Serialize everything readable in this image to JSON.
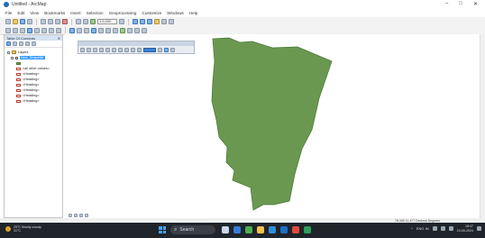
{
  "window": {
    "title": "Untitled - ArcMap",
    "controls": [
      "–",
      "□",
      "✕"
    ]
  },
  "menu": [
    "File",
    "Edit",
    "View",
    "Bookmarks",
    "Insert",
    "Selection",
    "Geoprocessing",
    "Customize",
    "Windows",
    "Help"
  ],
  "toolbar": {
    "scale": "1:6,000"
  },
  "toc": {
    "title": "Table Of Contents",
    "root": "Layers",
    "layer": "New_Shapefile",
    "classes": [
      "<all other values>",
      "<Heading>",
      "<Heading>",
      "<Heading>",
      "<Heading>",
      "<Heading>",
      "<Heading>"
    ]
  },
  "map": {
    "polygon_color": "#6a9850",
    "polygon_stroke": "#4e7a36"
  },
  "status": {
    "coordinates": "78.305  11.477 Decimal Degrees"
  },
  "taskbar": {
    "weather_temp": "29°C Mostly cloudy",
    "weather_sub": "31°C",
    "search_placeholder": "Search",
    "tray_lang": "ENG IN",
    "time": "18:47",
    "date": "19-05-2024"
  },
  "colors": {
    "taskbar_bg": "#20242b",
    "accent": "#3399ff"
  }
}
